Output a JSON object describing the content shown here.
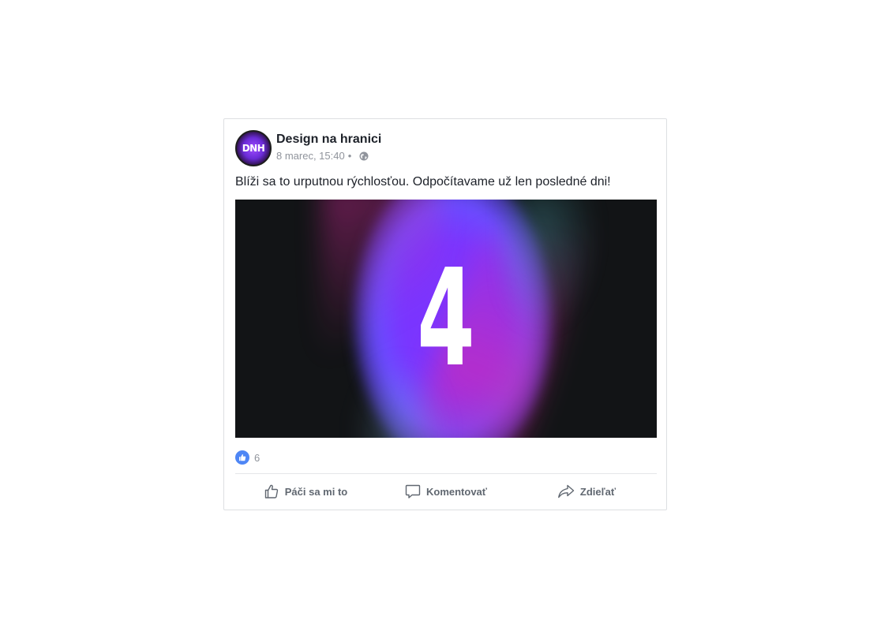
{
  "post": {
    "author": {
      "name": "Design na hranici",
      "avatar_text": "DNH",
      "avatar_colors": [
        "#a04cff",
        "#6a2bd6",
        "#111111"
      ]
    },
    "timestamp": "8 marec, 15:40",
    "separator": "•",
    "privacy_icon": "globe-icon",
    "text": "Blíži sa to urputnou rýchlosťou. Odpočítavame už len posledné dni!",
    "media": {
      "countdown_number": "4",
      "colors": [
        "#121416",
        "#7a35ff",
        "#e628a0"
      ]
    },
    "reactions": {
      "icon": "like-icon",
      "count": "6"
    },
    "actions": {
      "like_label": "Páči sa mi to",
      "comment_label": "Komentovať",
      "share_label": "Zdieľať"
    }
  }
}
